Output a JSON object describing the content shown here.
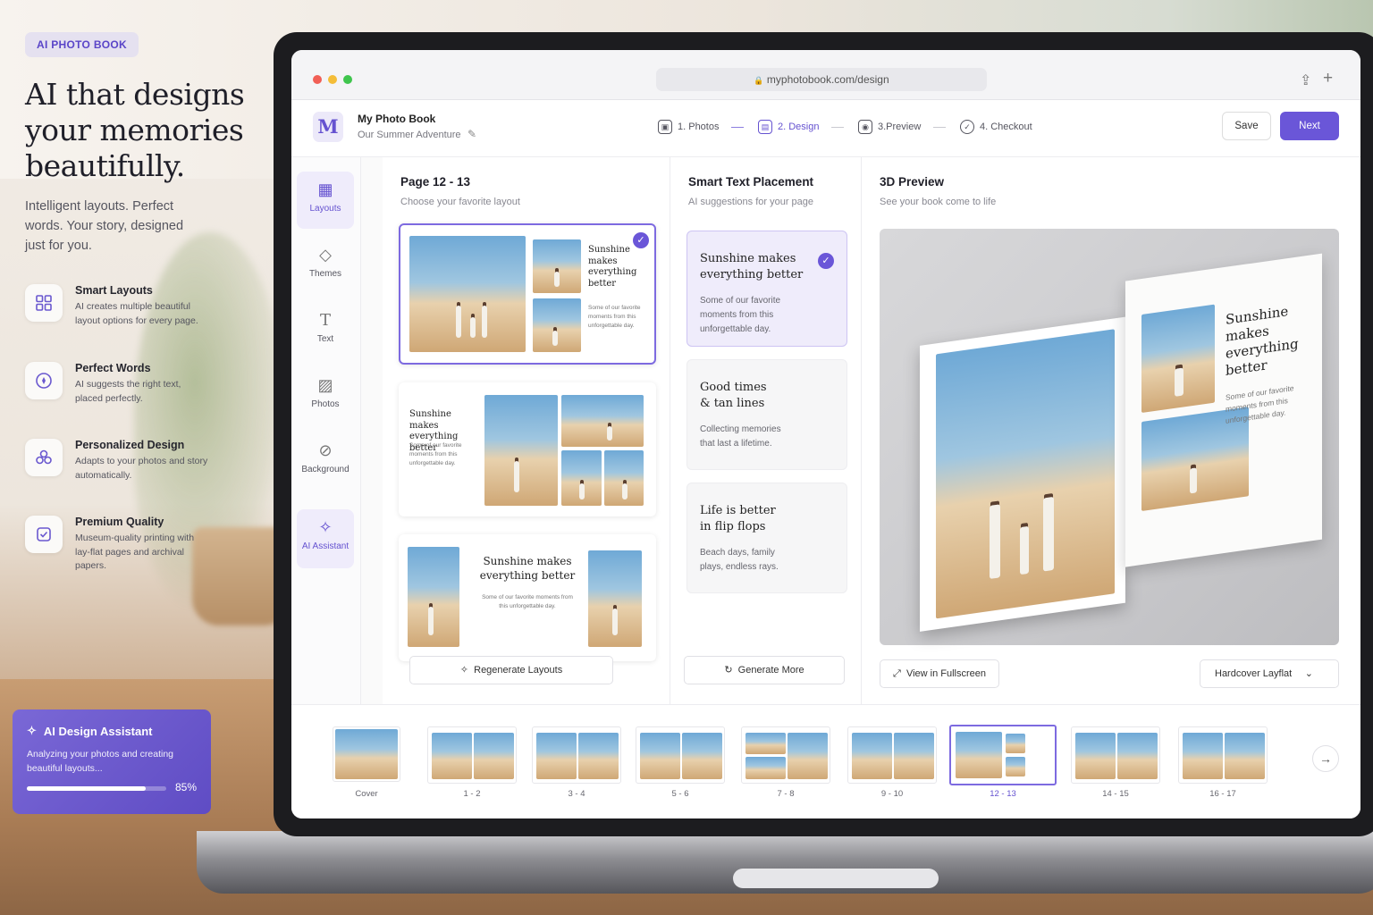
{
  "marketing": {
    "badge": "AI PHOTO BOOK",
    "headline": "AI that designs your memories beautifully.",
    "subhead": "Intelligent layouts. Perfect words. Your story, designed just for you.",
    "features": [
      {
        "title": "Smart Layouts",
        "desc": "AI creates multiple beautiful layout options for every page.",
        "icon": "grid-icon"
      },
      {
        "title": "Perfect Words",
        "desc": "AI suggests the right text, placed perfectly.",
        "icon": "pen-icon"
      },
      {
        "title": "Personalized Design",
        "desc": "Adapts to your photos and story automatically.",
        "icon": "people-icon"
      },
      {
        "title": "Premium Quality",
        "desc": "Museum-quality printing with lay-flat pages and archival papers.",
        "icon": "badge-check-icon"
      }
    ],
    "ai_card": {
      "title": "AI Design Assistant",
      "desc": "Analyzing your photos and creating beautiful layouts...",
      "progress": 0.85,
      "progress_label": "85%"
    }
  },
  "browser": {
    "url": "myphotobook.com/design"
  },
  "app": {
    "logo": "M",
    "project_title": "My Photo Book",
    "project_subtitle": "Our Summer Adventure",
    "steps": [
      "1. Photos",
      "2. Design",
      "3.Preview",
      "4. Checkout"
    ],
    "active_step": 1,
    "save_label": "Save",
    "next_label": "Next"
  },
  "sidebar": {
    "items": [
      {
        "label": "Layouts",
        "icon": "layout-grid-icon",
        "active": true
      },
      {
        "label": "Themes",
        "icon": "paint-bucket-icon",
        "active": false
      },
      {
        "label": "Text",
        "icon": "text-icon",
        "active": false
      },
      {
        "label": "Photos",
        "icon": "image-icon",
        "active": false
      },
      {
        "label": "Background",
        "icon": "background-icon",
        "active": false
      },
      {
        "label": "AI Assistant",
        "icon": "sparkle-icon",
        "active": true
      }
    ]
  },
  "layouts_panel": {
    "title": "Page 12 - 13",
    "subtitle": "Choose your favorite layout",
    "layout1_heading": "Sunshine makes everything better",
    "layout1_body": "Some of our favorite moments from this unforgettable day.",
    "layout2_heading": "Sunshine makes everything better",
    "layout2_body": "Some of our favorite moments from this unforgettable day.",
    "layout3_heading": "Sunshine makes everything better",
    "layout3_body": "Some of our favorite moments from this unforgettable day.",
    "regenerate_label": "Regenerate Layouts"
  },
  "text_panel": {
    "title": "Smart Text Placement",
    "subtitle": "AI suggestions for your page",
    "suggestions": [
      {
        "heading": "Sunshine makes everything better",
        "body": "Some of our favorite moments from this unforgettable day.",
        "selected": true
      },
      {
        "heading": "Good times & tan lines",
        "body": "Collecting memories that last a lifetime.",
        "selected": false
      },
      {
        "heading": "Life is better in flip flops",
        "body": "Beach days, family plays, endless rays.",
        "selected": false
      }
    ],
    "generate_label": "Generate More"
  },
  "preview_panel": {
    "title": "3D Preview",
    "subtitle": "See your book come to life",
    "book_heading": "Sunshine makes everything better",
    "book_body": "Some of our favorite moments from this unforgettable day.",
    "fullscreen_label": "View in Fullscreen",
    "format_value": "Hardcover Layflat"
  },
  "thumbnails": {
    "items": [
      "Cover",
      "1 - 2",
      "3 - 4",
      "5 - 6",
      "7 - 8",
      "9 - 10",
      "12 - 13",
      "14 - 15",
      "16 - 17"
    ],
    "selected_index": 6
  }
}
